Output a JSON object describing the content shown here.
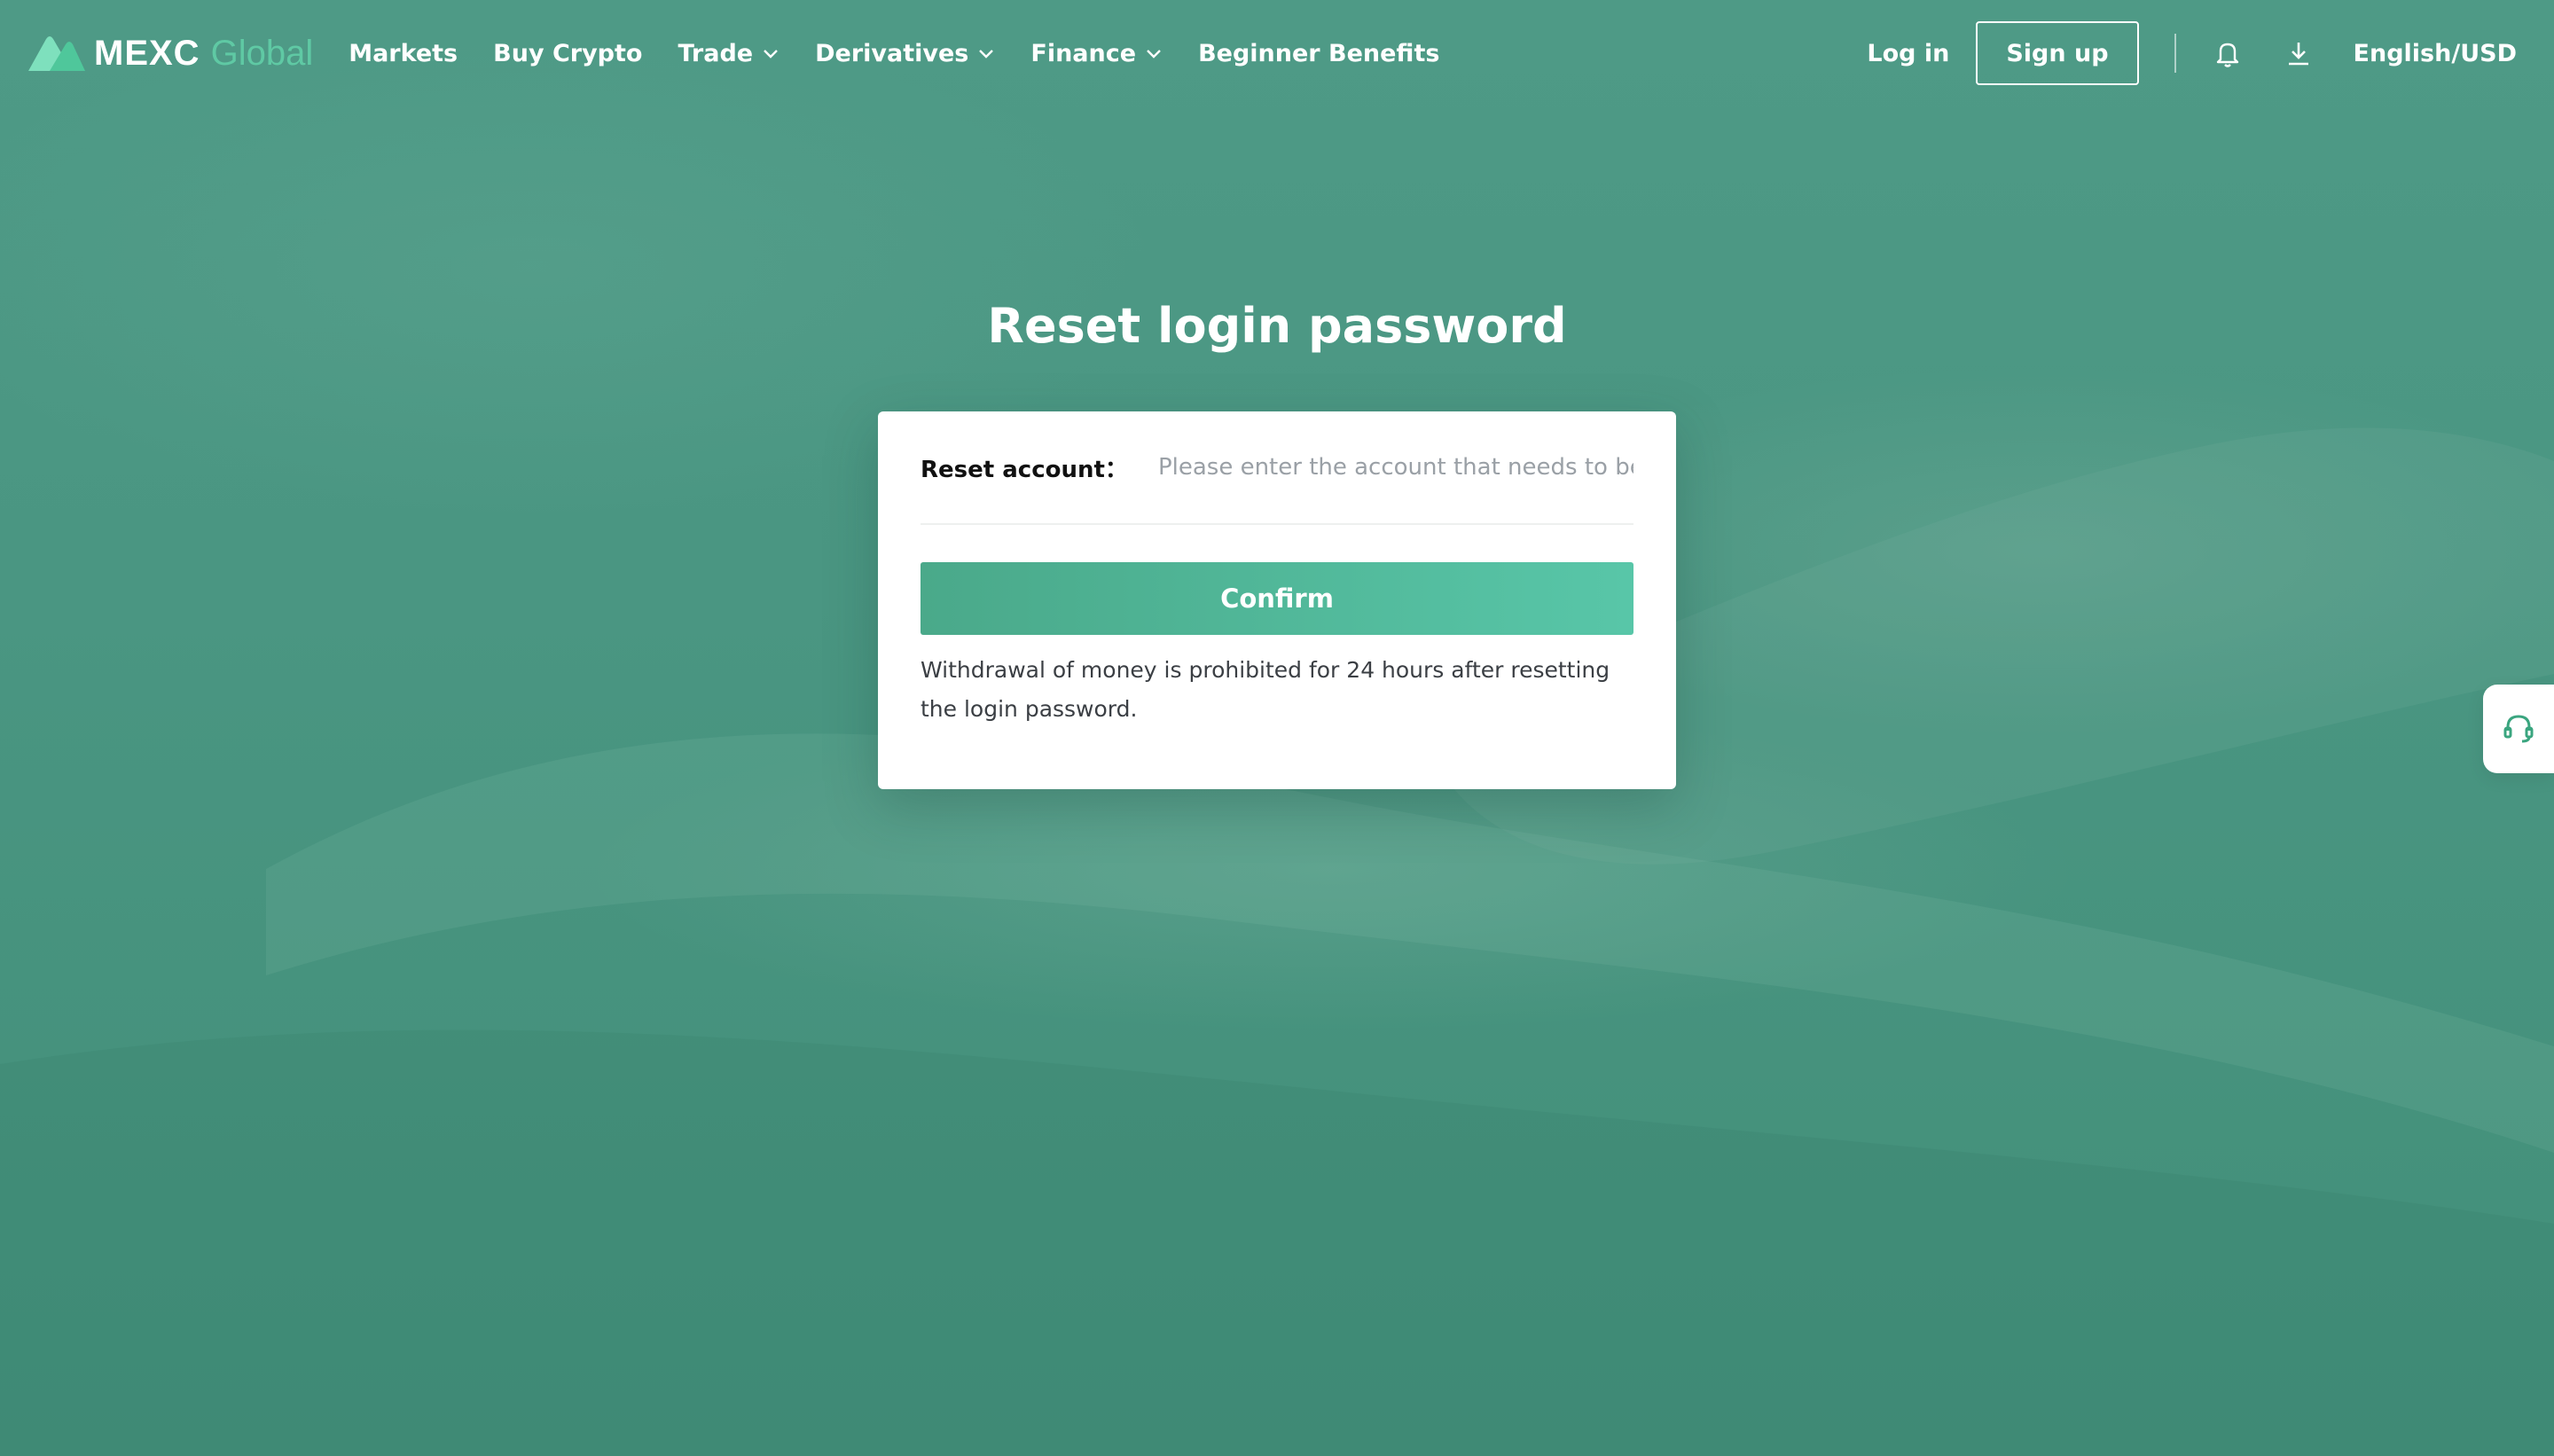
{
  "header": {
    "logo_text": "MEXC",
    "logo_sub": "Global",
    "nav": [
      {
        "label": "Markets"
      },
      {
        "label": "Buy Crypto"
      },
      {
        "label": "Trade"
      },
      {
        "label": "Derivatives"
      },
      {
        "label": "Finance"
      },
      {
        "label": "Beginner Benefits"
      }
    ],
    "login": "Log in",
    "signup": "Sign up",
    "language": "English/USD",
    "icons": [
      "bell-icon",
      "download-icon"
    ]
  },
  "main": {
    "title": "Reset login password",
    "form": {
      "account_label": "Reset account：",
      "account_placeholder": "Please enter the account that needs to be ...",
      "account_value": "",
      "confirm_label": "Confirm",
      "note": "Withdrawal of money is prohibited for 24 hours after resetting the login password."
    }
  },
  "support": {
    "icon": "headset-icon"
  },
  "colors": {
    "background": "#46937d",
    "accent": "#4aa98a",
    "accent_light": "#58c6a8",
    "logo_sub": "#5fc9a4"
  }
}
